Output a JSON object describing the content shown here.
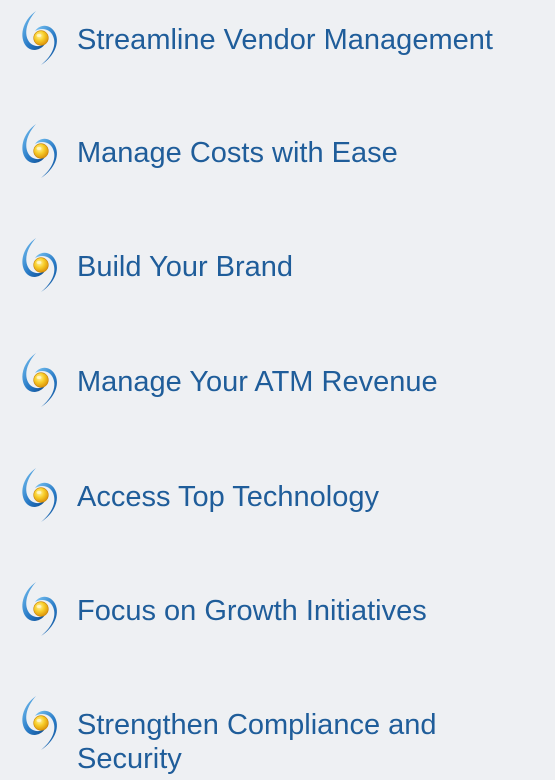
{
  "features": {
    "items": [
      {
        "label": "Streamline Vendor Management",
        "icon": "swirl-logo-icon"
      },
      {
        "label": "Manage Costs with Ease",
        "icon": "swirl-logo-icon"
      },
      {
        "label": "Build Your Brand",
        "icon": "swirl-logo-icon"
      },
      {
        "label": "Manage Your ATM Revenue",
        "icon": "swirl-logo-icon"
      },
      {
        "label": "Access Top Technology",
        "icon": "swirl-logo-icon"
      },
      {
        "label": "Focus on Growth Initiatives",
        "icon": "swirl-logo-icon"
      },
      {
        "label": "Strengthen Compliance and Security",
        "icon": "swirl-logo-icon"
      }
    ]
  },
  "colors": {
    "background": "#eef0f3",
    "text": "#1f5d9a",
    "icon_blue": "#2a7cc7",
    "icon_yellow": "#f5c21b"
  }
}
